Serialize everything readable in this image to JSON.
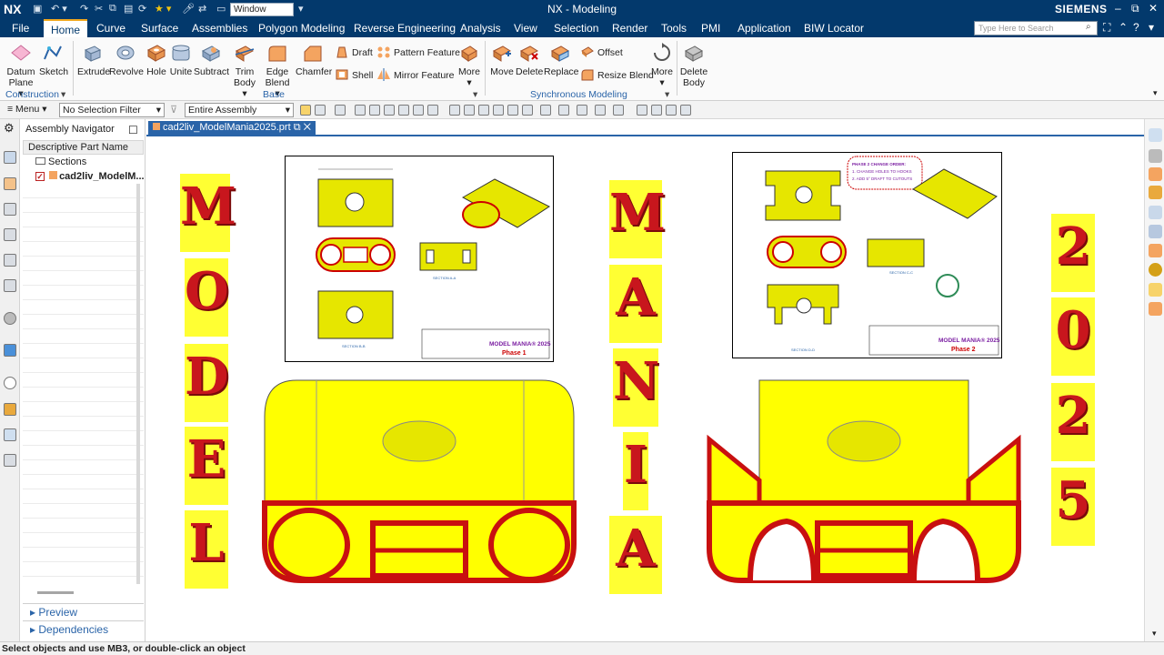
{
  "titlebar": {
    "app_short": "NX",
    "window_field": "Window",
    "title": "NX - Modeling",
    "brand": "SIEMENS"
  },
  "menubar": {
    "items": [
      "File",
      "Home",
      "Curve",
      "Surface",
      "Assemblies",
      "Polygon Modeling",
      "Reverse Engineering",
      "Analysis",
      "View",
      "Selection",
      "Render",
      "Tools",
      "PMI",
      "Application",
      "BIW Locator"
    ],
    "active": "Home",
    "search_placeholder": "Type Here to Search"
  },
  "ribbon": {
    "datum_plane": "Datum\nPlane",
    "sketch": "Sketch",
    "construction": "Construction",
    "extrude": "Extrude",
    "revolve": "Revolve",
    "hole": "Hole",
    "unite": "Unite",
    "subtract": "Subtract",
    "trim_body": "Trim\nBody",
    "edge_blend": "Edge\nBlend",
    "chamfer": "Chamfer",
    "draft": "Draft",
    "shell": "Shell",
    "pattern_feature": "Pattern Feature",
    "mirror_feature": "Mirror Feature",
    "more1": "More",
    "base": "Base",
    "move": "Move",
    "delete": "Delete",
    "replace": "Replace",
    "offset": "Offset",
    "resize_blend": "Resize Blend",
    "more2": "More",
    "synchronous_modeling": "Synchronous Modeling",
    "delete_body": "Delete\nBody"
  },
  "toolbar": {
    "menu": "Menu",
    "selection_filter": "No Selection Filter",
    "scope": "Entire Assembly"
  },
  "navigator": {
    "title": "Assembly Navigator",
    "column": "Descriptive Part Name",
    "rows": [
      "Sections",
      "cad2liv_ModelM..."
    ],
    "preview": "Preview",
    "dependencies": "Dependencies"
  },
  "document_tab": "cad2liv_ModelMania2025.prt",
  "canvas": {
    "word_model": [
      "M",
      "O",
      "D",
      "E",
      "L"
    ],
    "word_mania": [
      "M",
      "A",
      "N",
      "I",
      "A"
    ],
    "word_year": [
      "2",
      "0",
      "2",
      "5"
    ],
    "drawing1": {
      "title": "MODEL MANIA® 2025",
      "phase": "Phase 1",
      "section_aa": "SECTION A-A",
      "section_bb": "SECTION B-B"
    },
    "drawing2": {
      "title": "MODEL MANIA® 2025",
      "phase": "Phase 2",
      "order_title": "PHASE 2 CHANGE ORDER:",
      "order_1": "1. CHANGE HOLES TO HOOKS",
      "order_2": "2. ADD 5° DRAFT TO CUTOUTS",
      "section_cc": "SECTION C-C",
      "section_dd": "SECTION D-D"
    }
  },
  "status": "Select objects and use MB3, or double-click an object",
  "colors": {
    "nx_blue": "#03396c",
    "accent": "#2a64a8",
    "part_yellow": "#ffff00",
    "part_red": "#d01414"
  }
}
